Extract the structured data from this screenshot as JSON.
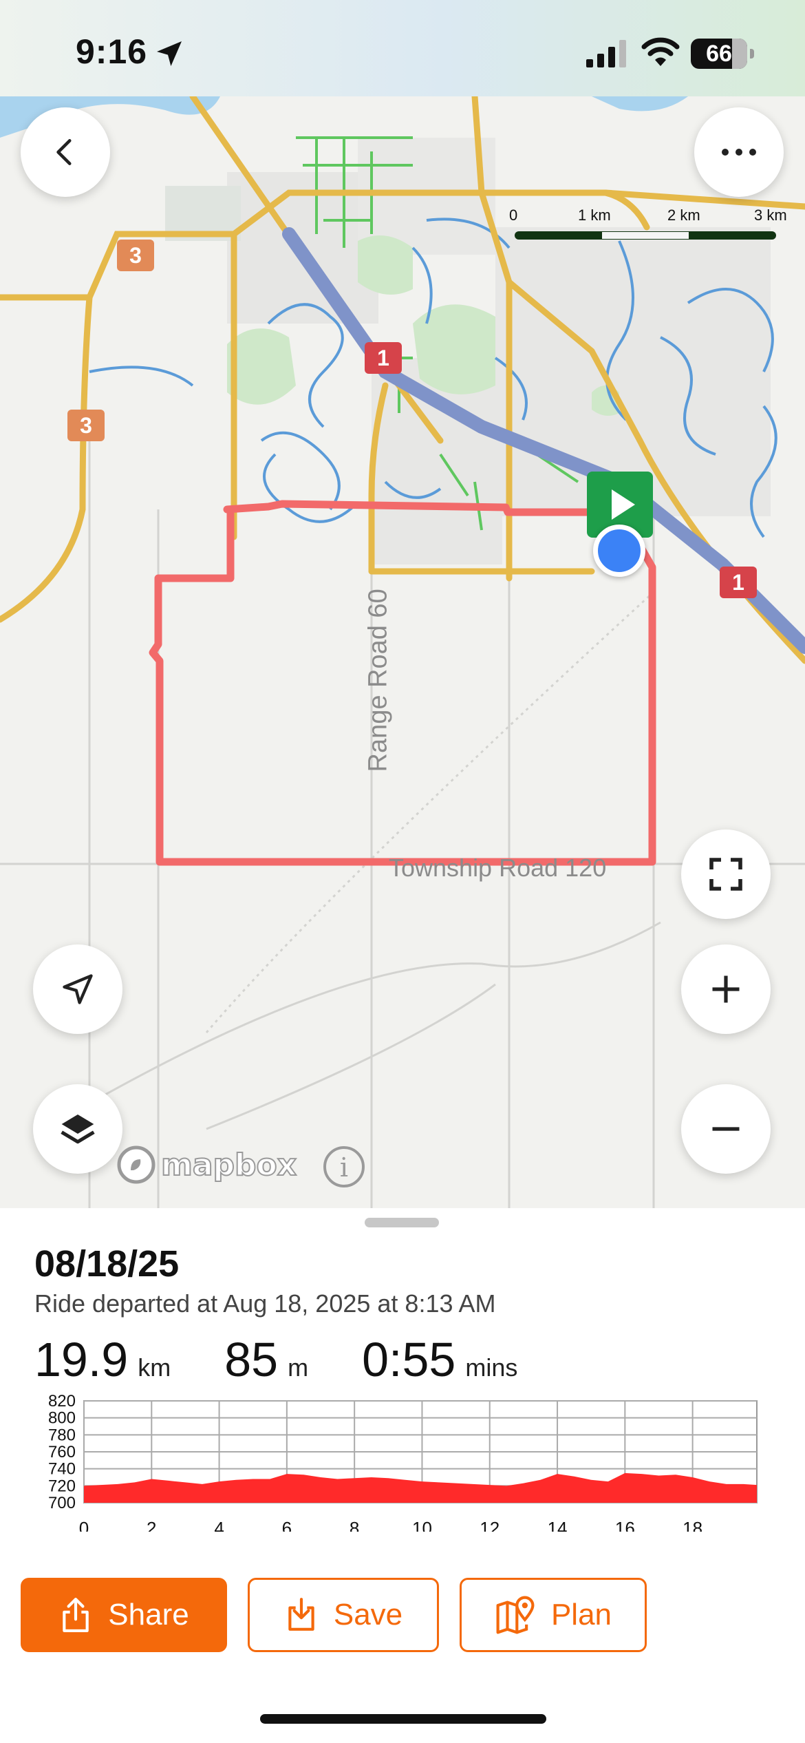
{
  "status_bar": {
    "time": "9:16",
    "battery": "66"
  },
  "map": {
    "scale_labels": [
      "0",
      "1 km",
      "2 km",
      "3 km"
    ],
    "road_labels": [
      "Range Road 60",
      "Township Road 120"
    ],
    "highway_shields": [
      "3",
      "3",
      "1",
      "1"
    ],
    "attribution": "mapbox",
    "info_symbol": "i"
  },
  "ride": {
    "date": "08/18/25",
    "departed": "Ride departed at Aug 18, 2025 at 8:13 AM",
    "distance": {
      "value": "19.9",
      "unit": "km"
    },
    "elevation": {
      "value": "85",
      "unit": "m"
    },
    "duration": {
      "value": "0:55",
      "unit": "mins"
    }
  },
  "chart_data": {
    "type": "area",
    "title": "",
    "xlabel": "",
    "ylabel": "",
    "y_ticks": [
      820,
      800,
      780,
      760,
      740,
      720,
      700
    ],
    "x_ticks": [
      0,
      2,
      4,
      6,
      8,
      10,
      12,
      14,
      16,
      18
    ],
    "xlim": [
      0,
      19.9
    ],
    "ylim": [
      700,
      820
    ],
    "grid": true,
    "color": "#ff2a2a",
    "x": [
      0,
      0.5,
      1,
      1.5,
      2,
      2.5,
      3,
      3.5,
      4,
      4.5,
      5,
      5.5,
      6,
      6.5,
      7,
      7.5,
      8,
      8.5,
      9,
      9.5,
      10,
      10.5,
      11,
      11.5,
      12,
      12.5,
      13,
      13.5,
      14,
      14.5,
      15,
      15.5,
      16,
      16.5,
      17,
      17.5,
      18,
      18.5,
      19,
      19.5,
      19.9
    ],
    "y": [
      720,
      721,
      722,
      724,
      728,
      726,
      724,
      722,
      725,
      727,
      728,
      728,
      734,
      733,
      730,
      728,
      729,
      730,
      729,
      727,
      725,
      724,
      723,
      722,
      721,
      720,
      723,
      727,
      734,
      731,
      727,
      725,
      735,
      734,
      732,
      733,
      730,
      725,
      722,
      722,
      721
    ]
  },
  "actions": {
    "share": "Share",
    "save": "Save",
    "plan": "Plan"
  },
  "colors": {
    "accent": "#f4690b",
    "route": "#f26a6a",
    "location": "#3b82f6",
    "start_marker": "#1e9e4a"
  }
}
